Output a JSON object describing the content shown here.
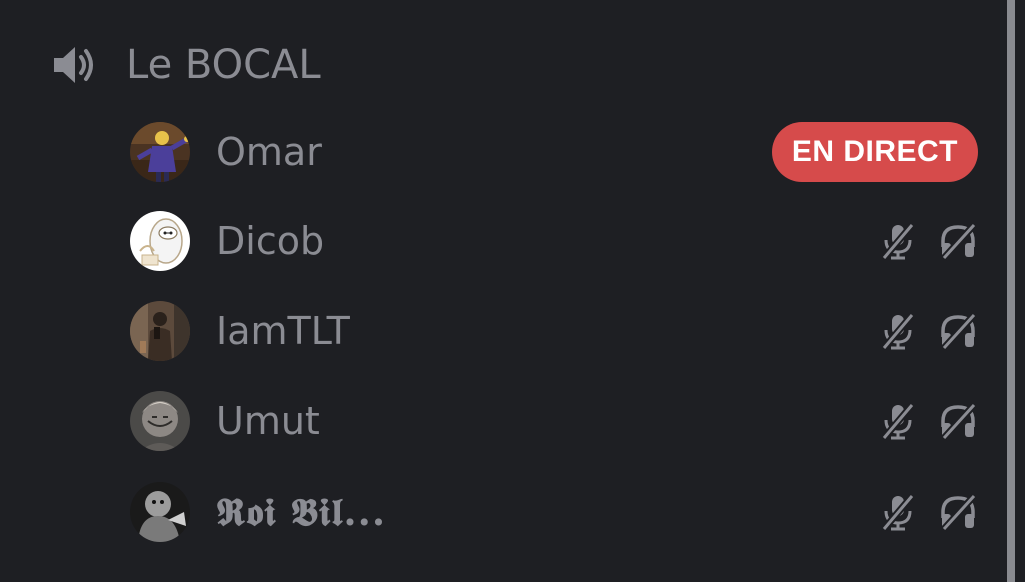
{
  "channel": {
    "name": "Le BOCAL",
    "icon": "speaker-icon"
  },
  "users": [
    {
      "name": "Omar",
      "badge": "EN DIRECT",
      "icons": []
    },
    {
      "name": "Dicob",
      "badge": "",
      "icons": [
        "mic-muted-icon",
        "headphones-deafened-icon"
      ]
    },
    {
      "name": "IamTLT",
      "badge": "",
      "icons": [
        "mic-muted-icon",
        "headphones-deafened-icon"
      ]
    },
    {
      "name": "Umut",
      "badge": "",
      "icons": [
        "mic-muted-icon",
        "headphones-deafened-icon"
      ]
    },
    {
      "name": "𝕽𝖔𝖎 𝕭𝖎𝖑...",
      "badge": "",
      "icons": [
        "mic-muted-icon",
        "headphones-deafened-icon"
      ]
    }
  ],
  "colors": {
    "background": "#1e1f23",
    "text_muted": "#8b8c93",
    "live_badge": "#d64b4b"
  }
}
